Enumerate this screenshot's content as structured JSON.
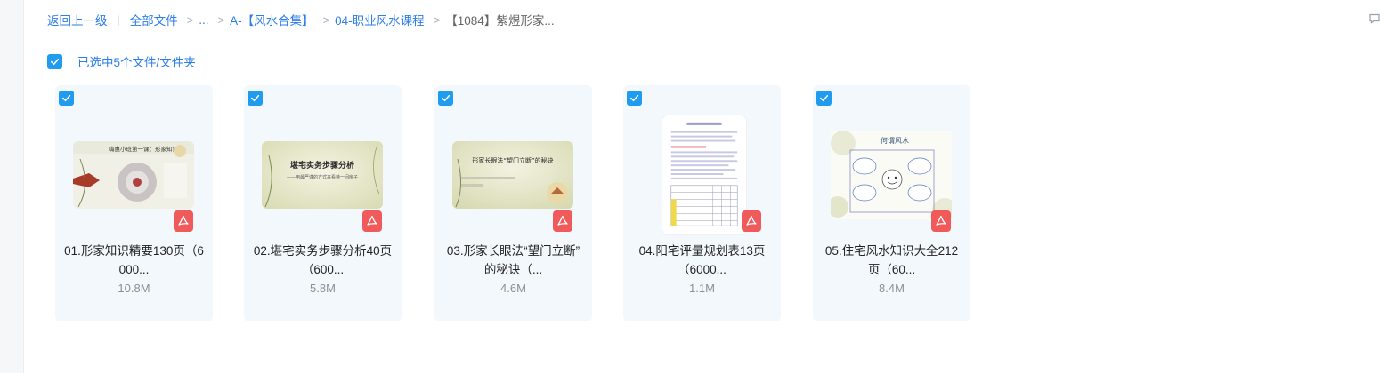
{
  "breadcrumb": {
    "back": "返回上一级",
    "all_files": "全部文件",
    "ellipsis": "...",
    "folder1": "A-【风水合集】",
    "folder2": "04-职业风水课程",
    "current": "【1084】紫煜形家..."
  },
  "selection": {
    "text": "已选中5个文件/文件夹"
  },
  "files": [
    {
      "name_line1": "01.形家知识精要130页（6",
      "name_line2": "000...",
      "size": "10.8M",
      "thumb_title": "嗨惠小班第一课：形家知识"
    },
    {
      "name_line1": "02.堪宅实务步骤分析40页",
      "name_line2": "（600...",
      "size": "5.8M",
      "thumb_title": "堪宅实务步骤分析",
      "thumb_subtitle": "——用最严谨的方式来看待一间房子"
    },
    {
      "name_line1": "03.形家长眼法“望门立断”",
      "name_line2": "的秘诀（...",
      "size": "4.6M",
      "thumb_title": "形家长眼法“望门立断”的秘诀"
    },
    {
      "name_line1": "04.阳宅评量规划表13页",
      "name_line2": "（6000...",
      "size": "1.1M"
    },
    {
      "name_line1": "05.住宅风水知识大全212",
      "name_line2": "页（60...",
      "size": "8.4M",
      "thumb_title": "何谓风水"
    }
  ],
  "colors": {
    "accent": "#2b7de9",
    "checkbox": "#1f9cf0",
    "card_bg": "#f3f8fd",
    "pdf_red": "#f05a5a"
  }
}
